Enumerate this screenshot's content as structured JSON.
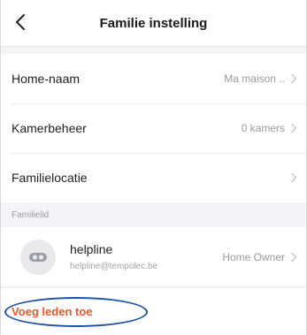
{
  "header": {
    "title": "Familie instelling",
    "back_icon": "chevron-left-icon"
  },
  "settings": {
    "items": [
      {
        "label": "Home-naam",
        "value": "Ma maison .."
      },
      {
        "label": "Kamerbeheer",
        "value": "0 kamers"
      },
      {
        "label": "Familielocatie",
        "value": ""
      }
    ]
  },
  "members": {
    "section_title": "Familielid",
    "list": [
      {
        "name": "helpline",
        "email": "helpline@tempolec.be",
        "role": "Home Owner"
      }
    ],
    "add_label": "Voeg leden toe"
  },
  "colors": {
    "accent": "#e8572e",
    "highlight_ring": "#1f4fa6",
    "muted_text": "#9a9a9a"
  }
}
